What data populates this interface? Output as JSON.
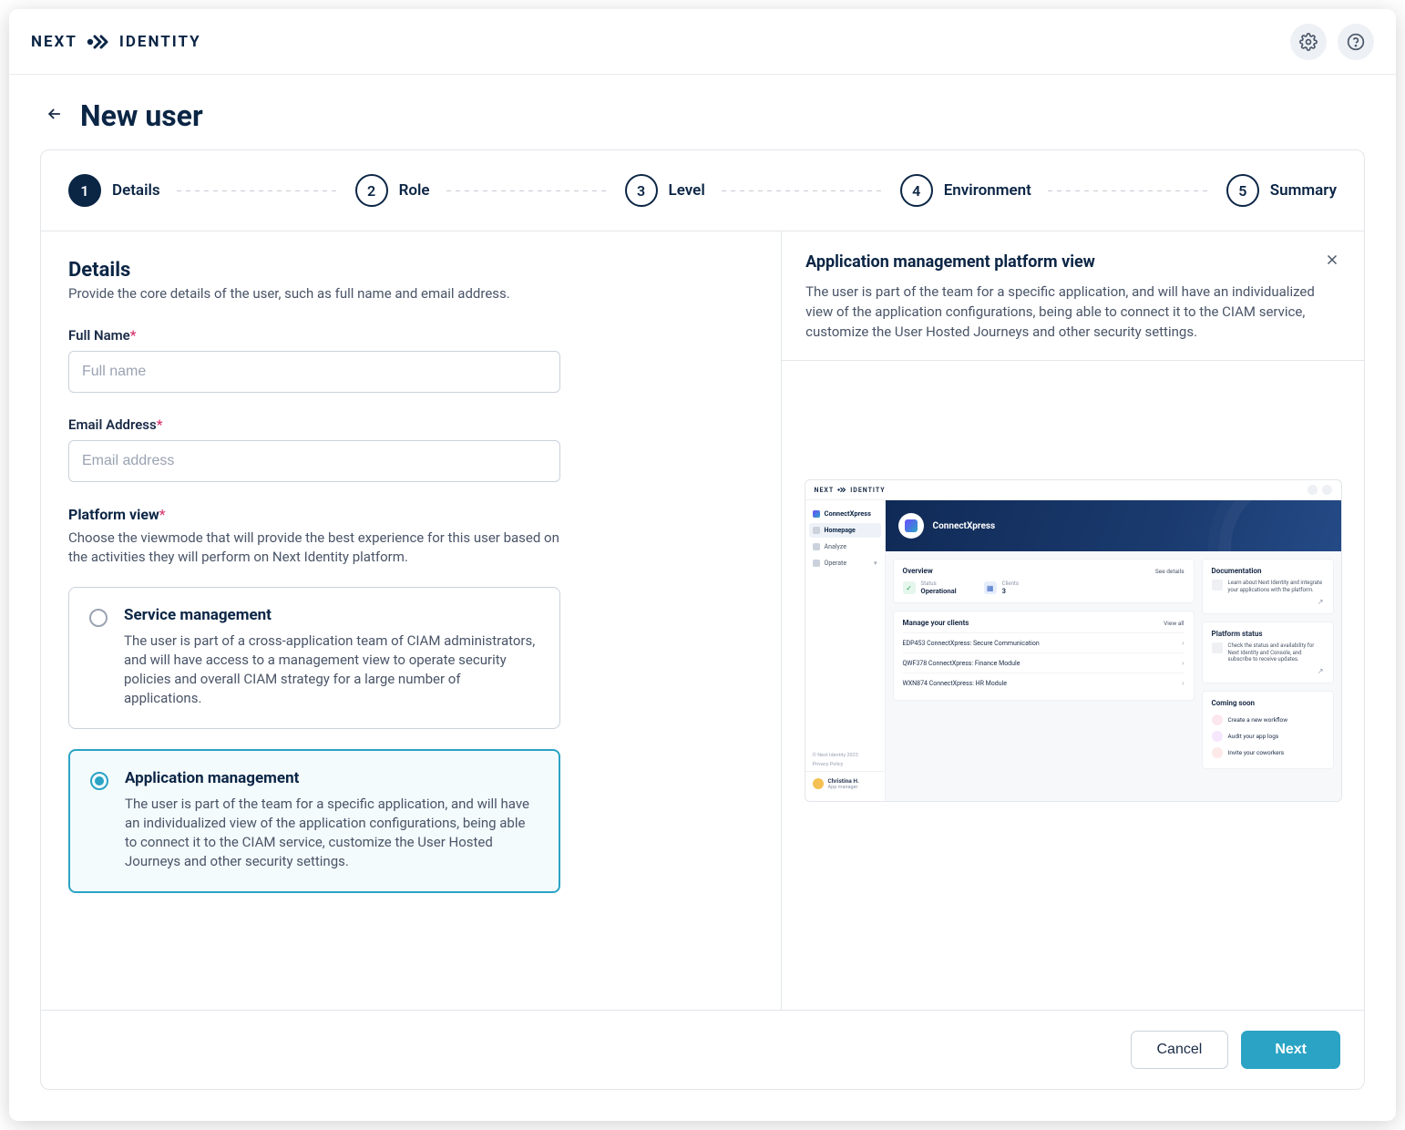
{
  "brand": {
    "part1": "NEXT",
    "part2": "IDENTITY"
  },
  "page": {
    "title": "New user"
  },
  "stepper": {
    "steps": [
      {
        "num": "1",
        "label": "Details"
      },
      {
        "num": "2",
        "label": "Role"
      },
      {
        "num": "3",
        "label": "Level"
      },
      {
        "num": "4",
        "label": "Environment"
      },
      {
        "num": "5",
        "label": "Summary"
      }
    ]
  },
  "details": {
    "heading": "Details",
    "sub": "Provide the core details of the user, such as full name and email address.",
    "full_name_label": "Full Name",
    "full_name_placeholder": "Full name",
    "email_label": "Email Address",
    "email_placeholder": "Email address",
    "platform_label": "Platform view",
    "platform_help": "Choose the viewmode that will provide the best experience for this user based on the activities they will perform on Next Identity platform."
  },
  "options": {
    "service": {
      "title": "Service management",
      "desc": "The user is part of a cross-application team of CIAM administrators, and will have access to a management view to operate security policies and overall CIAM strategy for a large number of applications."
    },
    "app": {
      "title": "Application management",
      "desc": "The user is part of the team for a specific application, and will have an individualized view of the application configurations, being able to connect it to the CIAM service, customize the User Hosted Journeys and other security settings."
    }
  },
  "right": {
    "title": "Application management platform view",
    "desc": "The user is part of the team for a specific application, and will have an individualized view of the application configurations, being able to connect it to the CIAM service, customize the User Hosted Journeys and other security settings."
  },
  "preview": {
    "brand1": "NEXT",
    "brand2": "IDENTITY",
    "app_name": "ConnectXpress",
    "side": {
      "items": [
        "Homepage",
        "Analyze",
        "Operate"
      ],
      "user_name": "Christina H.",
      "user_role": "App manager",
      "footer1": "© Next Identity 2023",
      "footer2": "Privacy Policy"
    },
    "hero_title": "ConnectXpress",
    "overview": {
      "title": "Overview",
      "link": "See details",
      "status_label": "Status",
      "status_value": "Operational",
      "clients_label": "Clients",
      "clients_value": "3"
    },
    "clients": {
      "title": "Manage your clients",
      "link": "View all",
      "rows": [
        "EDP453 ConnectXpress: Secure Communication",
        "QWF378 ConnectXpress: Finance Module",
        "WXN874 ConnectXpress: HR Module"
      ]
    },
    "doc": {
      "title": "Documentation",
      "text": "Learn about Next Identity and integrate your applications with the platform."
    },
    "status": {
      "title": "Platform status",
      "text": "Check the status and availability for Next Identity and Console, and subscribe to receive updates."
    },
    "soon": {
      "title": "Coming soon",
      "items": [
        "Create a new workflow",
        "Audit your app logs",
        "Invite your coworkers"
      ]
    }
  },
  "footer": {
    "cancel": "Cancel",
    "next": "Next"
  }
}
